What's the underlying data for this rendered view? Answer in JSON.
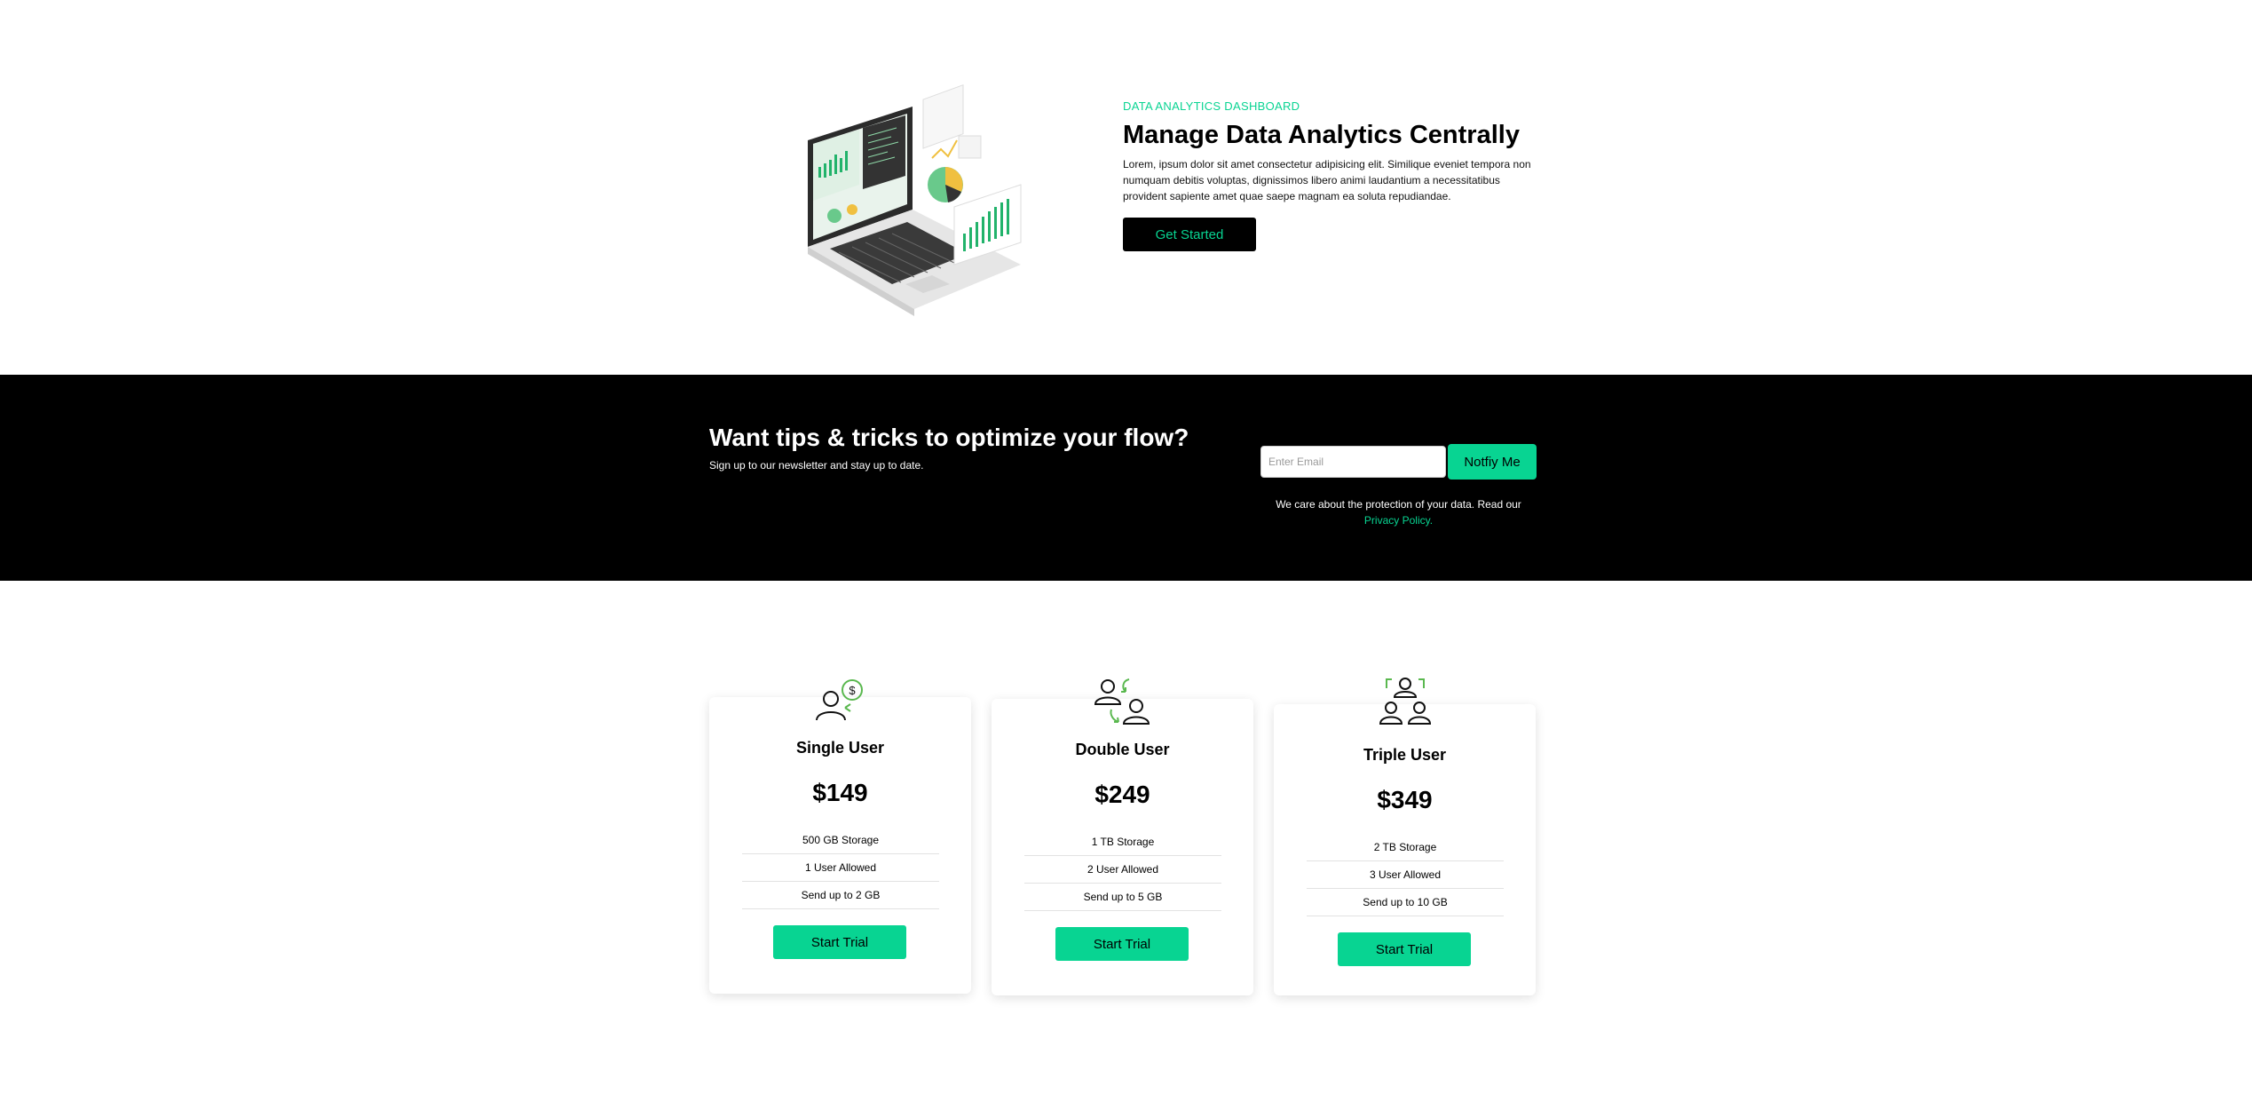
{
  "hero": {
    "eyebrow": "DATA ANALYTICS DASHBOARD",
    "title": "Manage Data Analytics Centrally",
    "description": "Lorem, ipsum dolor sit amet consectetur adipisicing elit. Similique eveniet tempora non numquam debitis voluptas, dignissimos libero animi laudantium a necessitatibus provident sapiente amet quae saepe magnam ea soluta repudiandae.",
    "cta_label": "Get Started",
    "illustration": "laptop-analytics-illustration"
  },
  "newsletter": {
    "title": "Want tips & tricks to optimize your flow?",
    "subtitle": "Sign up to our newsletter and stay up to date.",
    "email_placeholder": "Enter Email",
    "button_label": "Notfiy Me",
    "privacy_prefix": "We care about the protection of your data. Read our",
    "privacy_link": "Privacy Policy",
    "privacy_suffix": "."
  },
  "pricing": {
    "plans": [
      {
        "icon": "user-dollar-icon",
        "name": "Single User",
        "price": "$149",
        "features": [
          "500 GB Storage",
          "1 User Allowed",
          "Send up to 2 GB"
        ],
        "cta": "Start Trial"
      },
      {
        "icon": "users-exchange-icon",
        "name": "Double User",
        "price": "$249",
        "features": [
          "1 TB Storage",
          "2 User Allowed",
          "Send up to 5 GB"
        ],
        "cta": "Start Trial"
      },
      {
        "icon": "users-group-icon",
        "name": "Triple User",
        "price": "$349",
        "features": [
          "2 TB Storage",
          "3 User Allowed",
          "Send up to 10 GB"
        ],
        "cta": "Start Trial"
      }
    ]
  },
  "colors": {
    "accent": "#08d492",
    "dark": "#000000",
    "background": "#ffffff"
  }
}
